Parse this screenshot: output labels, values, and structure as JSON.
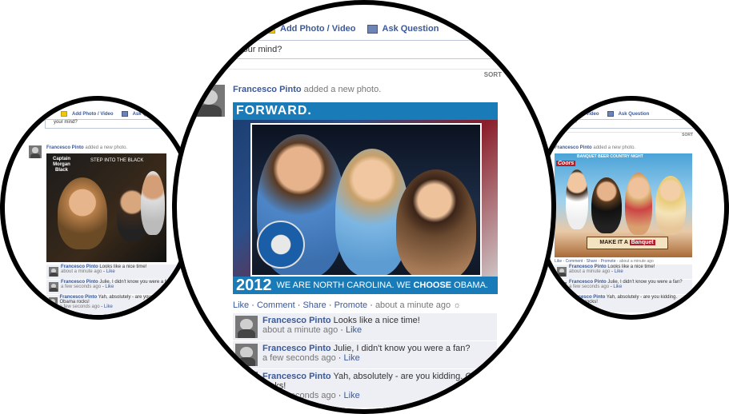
{
  "composer": {
    "add_photo": "Add Photo / Video",
    "ask_question": "Ask Question",
    "status_placeholder": "your mind?",
    "sort_label": "SORT"
  },
  "main_post": {
    "author": "Francesco Pinto",
    "action": "added a new photo.",
    "photo": {
      "banner_top": "FORWARD.",
      "year": "2012",
      "caption_pre": "WE ARE NORTH CAROLINA. WE ",
      "caption_bold": "CHOOSE",
      "caption_post": " OBAMA."
    },
    "actions": [
      "Like",
      "Comment",
      "Share",
      "Promote"
    ],
    "time": "about a minute ago"
  },
  "comments": [
    {
      "author": "Francesco Pinto",
      "text": "Looks like a nice time!",
      "time": "about a minute ago",
      "like": "Like"
    },
    {
      "author": "Francesco Pinto",
      "text": "Julie, I didn't know you were a fan?",
      "time": "a few seconds ago",
      "like": "Like"
    },
    {
      "author": "Francesco Pinto",
      "text": "Yah, absolutely - are you kidding. Obama rocks!",
      "time": "a few seconds ago",
      "like": "Like"
    }
  ],
  "left_post": {
    "photo_logo": "Captain Morgan Black",
    "photo_slogan": "STEP INTO THE BLACK",
    "comment3_text": "Yah, absolutely - are you kidding. Obama rocks!"
  },
  "right_post": {
    "photo_banner": "BANQUET BEER COUNTRY NIGHT",
    "photo_logo": "Coors",
    "photo_tag": "MAKE IT A",
    "photo_brand": "Banquet",
    "actions": [
      "Like",
      "Comment",
      "Share",
      "Promote"
    ],
    "time": "about a minute ago"
  },
  "colors": {
    "link": "#3b5998",
    "comment_bg": "#edeff4",
    "obama_blue": "#1a7bb9"
  }
}
